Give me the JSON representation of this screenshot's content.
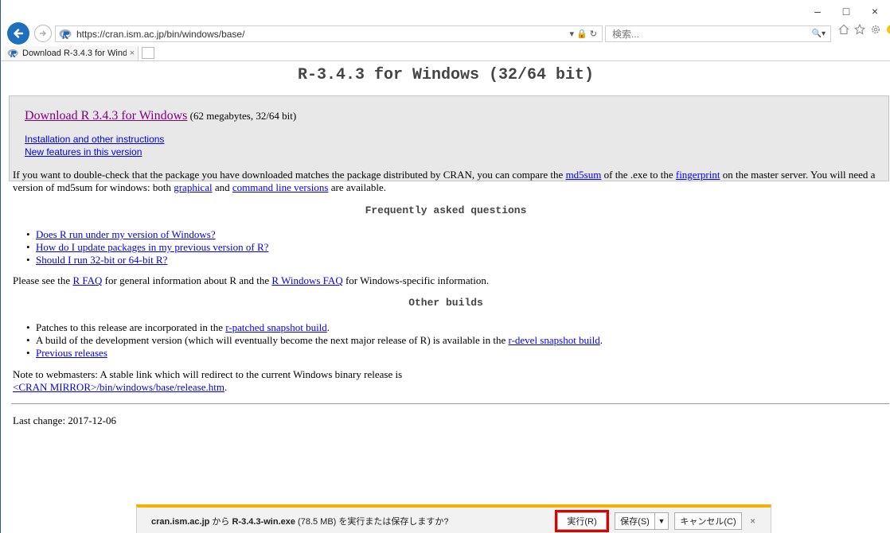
{
  "browser": {
    "url": "https://cran.ism.ac.jp/bin/windows/base/",
    "search_placeholder": "検索...",
    "tab_title": "Download R-3.4.3 for Wind...",
    "tab_close": "×",
    "window_minimize": "–",
    "window_maximize": "□",
    "window_close": "×",
    "addr_tools": "▾ 🔒 ↻",
    "search_tools": "🔍▾"
  },
  "page": {
    "title": "R-3.4.3 for Windows (32/64 bit)",
    "download": {
      "link_text": "Download R 3.4.3 for Windows",
      "size_text": " (62 megabytes, 32/64 bit)",
      "links": [
        "Installation and other instructions",
        "New features in this version"
      ]
    },
    "check": {
      "t1": "If you want to double-check that the package you have downloaded matches the package distributed by CRAN, you can compare the ",
      "l1": "md5sum",
      "t2": " of the .exe to the ",
      "l2": "fingerprint",
      "t3": " on the master server. You will need a version of md5sum for windows: both ",
      "l3": "graphical",
      "t4": " and ",
      "l4": "command line versions",
      "t5": " are available."
    },
    "faq_heading": "Frequently asked questions",
    "faq_items": [
      "Does R run under my version of Windows?",
      "How do I update packages in my previous version of R?",
      "Should I run 32-bit or 64-bit R?"
    ],
    "rfaq": {
      "t1": "Please see the ",
      "l1": "R FAQ",
      "t2": " for general information about R and the ",
      "l2": "R Windows FAQ",
      "t3": " for Windows-specific information."
    },
    "other_heading": "Other builds",
    "other": {
      "i1_text": "Patches to this release are incorporated in the ",
      "i1_link": "r-patched snapshot build",
      "i1_end": ".",
      "i2_text": "A build of the development version (which will eventually become the next major release of R) is available in the ",
      "i2_link": "r-devel snapshot build",
      "i2_end": ".",
      "i3_link": "Previous releases"
    },
    "webmasters": {
      "text": "Note to webmasters: A stable link which will redirect to the current Windows binary release is",
      "link": "<CRAN MIRROR>/bin/windows/base/release.htm",
      "end": "."
    },
    "last_change": "Last change: 2017-12-06"
  },
  "download_bar": {
    "host": "cran.ism.ac.jp",
    "mid1": " から ",
    "file": "R-3.4.3-win.exe",
    "mid2": " (78.5 MB) を実行または保存しますか?",
    "run": "実行(R)",
    "save": "保存(S)",
    "save_menu": "▼",
    "cancel": "キャンセル(C)",
    "close": "×"
  },
  "colors": {
    "accent": "#1e6fbd",
    "visited_link": "#800080",
    "link": "#0000ee",
    "highlight": "#e00000",
    "notify": "#f0b400"
  }
}
